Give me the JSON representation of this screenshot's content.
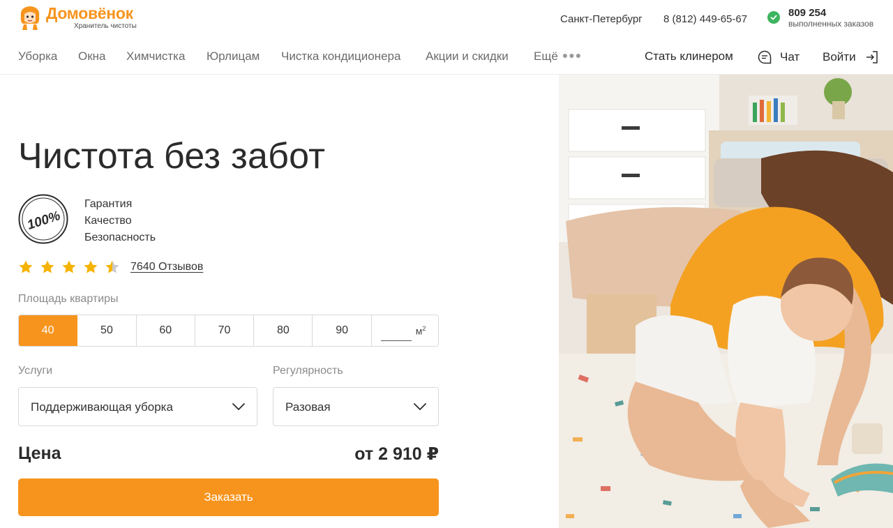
{
  "header": {
    "logo_name": "Домовёнок",
    "logo_tagline": "Хранитель чистоты",
    "city": "Санкт-Петербург",
    "phone": "8 (812) 449-65-67",
    "orders_count": "809 254",
    "orders_label": "выполненных заказов"
  },
  "nav": {
    "items": [
      "Уборка",
      "Окна",
      "Химчистка",
      "Юрлицам",
      "Чистка кондиционера",
      "Акции и скидки"
    ],
    "more_label": "Ещё",
    "become_cleaner": "Стать клинером",
    "chat": "Чат",
    "login": "Войти"
  },
  "hero": {
    "title": "Чистота без забот",
    "badge_text": "100%",
    "guarantees": [
      "Гарантия",
      "Качество",
      "Безопасность"
    ],
    "rating_value": 4.5,
    "rating_max": 5,
    "reviews_text": "7640 Отзывов"
  },
  "form": {
    "area_label": "Площадь квартиры",
    "area_options": [
      "40",
      "50",
      "60",
      "70",
      "80",
      "90"
    ],
    "area_selected": "40",
    "area_unit": "м",
    "area_unit_sup": "2",
    "services_label": "Услуги",
    "services_value": "Поддерживающая уборка",
    "regularity_label": "Регулярность",
    "regularity_value": "Разовая",
    "price_label": "Цена",
    "price_value": "от 2 910 ₽",
    "order_button": "Заказать"
  },
  "colors": {
    "brand_orange": "#f7941d",
    "check_green": "#3db55f",
    "star_yellow": "#f5b301"
  },
  "icons": {
    "check": "check-circle-icon",
    "more": "more-dots-icon",
    "chat": "chat-bubble-icon",
    "login": "login-arrow-icon",
    "star": "star-icon",
    "chevron": "chevron-down-icon"
  }
}
